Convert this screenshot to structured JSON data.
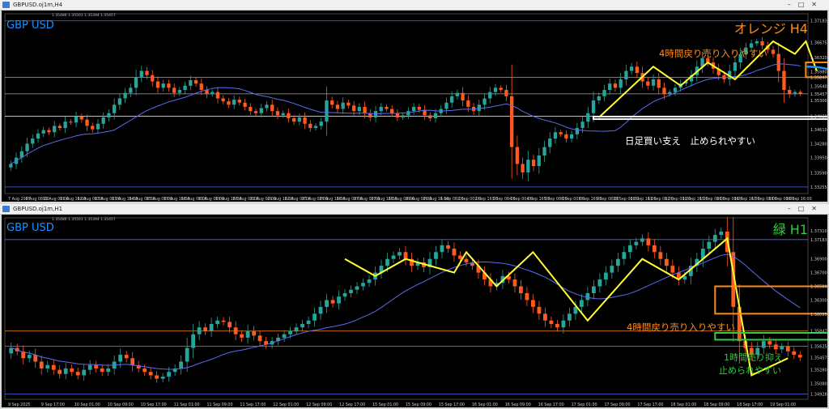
{
  "top": {
    "window_title": "GBPUSD.oj1m,H4",
    "ohlc_line": "1.35486 1.35501 1.35394 1.35457",
    "symbol_label": "GBP USD",
    "corner_label": "オレンジ H4",
    "price_labels": [
      "1.37183",
      "1.36675",
      "1.36320",
      "1.35980",
      "1.35847",
      "1.35640",
      "1.35457",
      "1.35300",
      "1.34928",
      "1.34610",
      "1.34280",
      "1.33950",
      "1.33590",
      "1.33255"
    ],
    "time_labels": [
      "7 Aug 2025",
      "8 Aug 08:00",
      "11 Aug 00:00",
      "11 Aug 16:00",
      "12 Aug 08:00",
      "13 Aug 00:00",
      "13 Aug 16:00",
      "14 Aug 08:00",
      "15 Aug 00:00",
      "15 Aug 16:00",
      "18 Aug 08:00",
      "19 Aug 00:00",
      "19 Aug 16:00",
      "20 Aug 08:00",
      "21 Aug 00:00",
      "21 Aug 16:00",
      "22 Aug 08:00",
      "25 Aug 00:00",
      "25 Aug 16:00",
      "26 Aug 08:00",
      "27 Aug 00:00",
      "27 Aug 16:00",
      "28 Aug 08:00",
      "29 Aug 00:00",
      "29 Aug 16:00",
      "1 Sep 08:00",
      "2 Sep 00:00",
      "2 Sep 16:00",
      "3 Sep 08:00",
      "4 Sep 00:00",
      "4 Sep 16:00",
      "5 Sep 08:00",
      "8 Sep 00:00",
      "8 Sep 16:00",
      "9 Sep 08:00",
      "10 Sep 00:00",
      "10 Sep 16:00",
      "11 Sep 08:00",
      "12 Sep 00:00",
      "12 Sep 16:00",
      "15 Sep 08:00",
      "16 Sep 00:00",
      "16 Sep 16:00",
      "17 Sep 08:00",
      "18 Sep 00:00",
      "18 Sep 16:00"
    ],
    "annotation_resistance": "4時間戻り売り入りやすい",
    "annotation_support": "日足買い支え　止められやすい",
    "colors": {
      "bull": "#26a69a",
      "bear": "#ff5a1f",
      "ma": "#5a6cf0",
      "zigzag": "#ffff33",
      "resist_box": "#ff8c1a",
      "arrow_blue": "#1e90ff",
      "arrow_pink": "#ff1493",
      "support_box": "#ffffff",
      "label_blue": "#1e90ff",
      "label_orange": "#ff8c1a"
    }
  },
  "bottom": {
    "window_title": "GBPUSD.oj1m,H1",
    "ohlc_line": "1.35486 1.35501 1.35394 1.35457",
    "symbol_label": "GBP USD",
    "corner_label": "緑 H1",
    "price_labels": [
      "1.37310",
      "1.37183",
      "1.36900",
      "1.36700",
      "1.36500",
      "1.36300",
      "1.36095",
      "1.35847",
      "1.35625",
      "1.35457",
      "1.35280",
      "1.35080",
      "1.34928"
    ],
    "time_labels": [
      "9 Sep 2025",
      "9 Sep 17:00",
      "10 Sep 01:00",
      "10 Sep 09:00",
      "10 Sep 17:00",
      "11 Sep 01:00",
      "11 Sep 09:00",
      "11 Sep 17:00",
      "12 Sep 01:00",
      "12 Sep 09:00",
      "12 Sep 17:00",
      "15 Sep 01:00",
      "15 Sep 09:00",
      "15 Sep 17:00",
      "16 Sep 01:00",
      "16 Sep 09:00",
      "16 Sep 17:00",
      "17 Sep 01:00",
      "17 Sep 09:00",
      "17 Sep 17:00",
      "18 Sep 01:00",
      "18 Sep 09:00",
      "18 Sep 17:00",
      "19 Sep 01:00"
    ],
    "annotation_resistance": "4時間戻り売り入りやすい",
    "annotation_support_line1": "1時間売り抑え",
    "annotation_support_line2": "止められやすい",
    "colors": {
      "bull": "#26a69a",
      "bear": "#ff5a1f",
      "ma": "#5a6cf0",
      "zigzag": "#ffff33",
      "resist_box": "#ff8c1a",
      "support_box": "#2ecc40",
      "label_blue": "#1e90ff",
      "label_green": "#2ecc40"
    }
  },
  "chart_data": [
    {
      "type": "candlestick",
      "title": "GBPUSD.oj1m,H4",
      "ylim": [
        1.331,
        1.3735
      ],
      "close": [
        1.338,
        1.3395,
        1.341,
        1.3428,
        1.344,
        1.3452,
        1.346,
        1.3455,
        1.347,
        1.3465,
        1.348,
        1.3478,
        1.3492,
        1.3485,
        1.347,
        1.3462,
        1.3475,
        1.349,
        1.35,
        1.352,
        1.3535,
        1.3548,
        1.356,
        1.3585,
        1.36,
        1.359,
        1.3575,
        1.356,
        1.357,
        1.356,
        1.3548,
        1.3555,
        1.3565,
        1.3578,
        1.357,
        1.3555,
        1.3545,
        1.355,
        1.3535,
        1.3528,
        1.352,
        1.3532,
        1.3525,
        1.3515,
        1.3505,
        1.35,
        1.3512,
        1.352,
        1.3505,
        1.3495,
        1.35,
        1.3488,
        1.348,
        1.349,
        1.3475,
        1.3465,
        1.347,
        1.348,
        1.353,
        1.352,
        1.351,
        1.3525,
        1.3518,
        1.3505,
        1.3515,
        1.35,
        1.349,
        1.3505,
        1.3515,
        1.351,
        1.35,
        1.349,
        1.3495,
        1.3505,
        1.3515,
        1.3508,
        1.3495,
        1.3488,
        1.35,
        1.351,
        1.3525,
        1.354,
        1.3548,
        1.353,
        1.3515,
        1.3505,
        1.352,
        1.3535,
        1.355,
        1.356,
        1.3555,
        1.354,
        1.342,
        1.338,
        1.336,
        1.339,
        1.3375,
        1.34,
        1.342,
        1.344,
        1.3455,
        1.345,
        1.344,
        1.345,
        1.3465,
        1.348,
        1.35,
        1.353,
        1.354,
        1.3555,
        1.357,
        1.356,
        1.358,
        1.36,
        1.361,
        1.3595,
        1.3575,
        1.3565,
        1.358,
        1.356,
        1.3545,
        1.355,
        1.356,
        1.357,
        1.3575,
        1.359,
        1.361,
        1.363,
        1.362,
        1.3605,
        1.359,
        1.358,
        1.36,
        1.362,
        1.364,
        1.3655,
        1.3665,
        1.367,
        1.366,
        1.365,
        1.364,
        1.36,
        1.3555,
        1.3545,
        1.355,
        1.3546
      ]
    },
    {
      "type": "candlestick",
      "title": "GBPUSD.oj1m,H1",
      "ylim": [
        1.3485,
        1.375
      ],
      "close": [
        1.356,
        1.3555,
        1.3545,
        1.355,
        1.354,
        1.353,
        1.3535,
        1.3528,
        1.3522,
        1.353,
        1.3525,
        1.352,
        1.3528,
        1.3535,
        1.353,
        1.3525,
        1.353,
        1.354,
        1.355,
        1.3545,
        1.3535,
        1.353,
        1.3525,
        1.352,
        1.3515,
        1.3518,
        1.3525,
        1.353,
        1.354,
        1.356,
        1.358,
        1.359,
        1.3585,
        1.3595,
        1.36,
        1.3598,
        1.359,
        1.358,
        1.3575,
        1.3585,
        1.3578,
        1.357,
        1.3565,
        1.357,
        1.3575,
        1.358,
        1.3585,
        1.359,
        1.3595,
        1.36,
        1.361,
        1.362,
        1.363,
        1.3625,
        1.3635,
        1.364,
        1.3645,
        1.365,
        1.3655,
        1.366,
        1.367,
        1.368,
        1.369,
        1.3695,
        1.37,
        1.369,
        1.368,
        1.3685,
        1.3678,
        1.369,
        1.37,
        1.371,
        1.3705,
        1.3695,
        1.369,
        1.3685,
        1.368,
        1.367,
        1.366,
        1.365,
        1.3655,
        1.3665,
        1.366,
        1.365,
        1.364,
        1.363,
        1.362,
        1.361,
        1.36,
        1.3595,
        1.359,
        1.36,
        1.361,
        1.362,
        1.363,
        1.364,
        1.365,
        1.366,
        1.367,
        1.368,
        1.369,
        1.37,
        1.371,
        1.3715,
        1.372,
        1.371,
        1.37,
        1.369,
        1.368,
        1.367,
        1.366,
        1.3665,
        1.368,
        1.369,
        1.3705,
        1.3715,
        1.3725,
        1.373,
        1.37,
        1.362,
        1.357,
        1.356,
        1.355,
        1.356,
        1.357,
        1.3565,
        1.3558,
        1.3562,
        1.3555,
        1.355,
        1.3546
      ]
    }
  ]
}
